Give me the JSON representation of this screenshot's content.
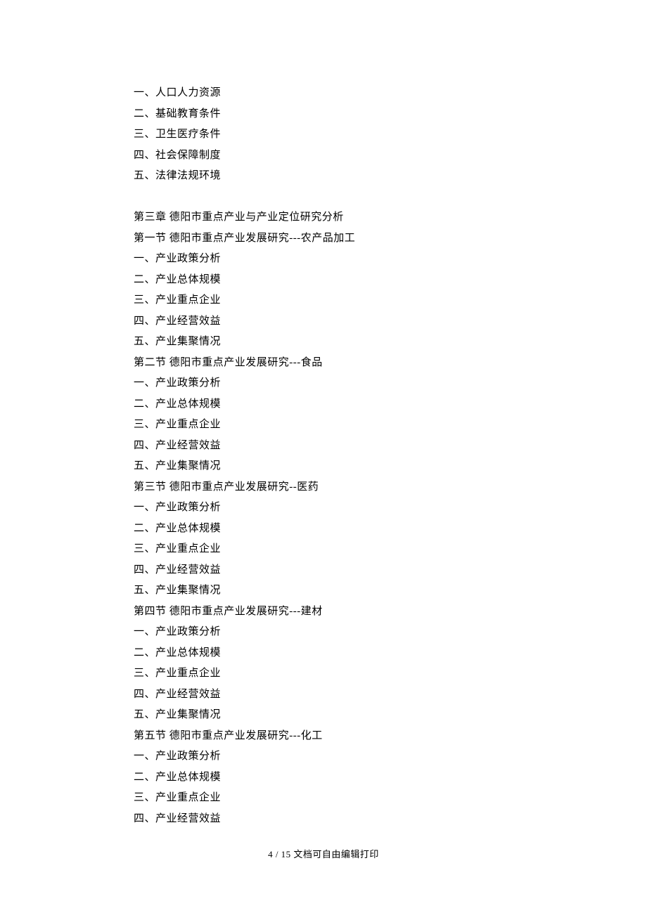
{
  "lines": [
    "一、人口人力资源",
    "二、基础教育条件",
    "三、卫生医疗条件",
    "四、社会保障制度",
    "五、法律法规环境",
    "",
    "第三章  德阳市重点产业与产业定位研究分析",
    "第一节  德阳市重点产业发展研究---农产品加工",
    "一、产业政策分析",
    "二、产业总体规模",
    "三、产业重点企业",
    "四、产业经营效益",
    "五、产业集聚情况",
    "第二节  德阳市重点产业发展研究---食品",
    "一、产业政策分析",
    "二、产业总体规模",
    "三、产业重点企业",
    "四、产业经营效益",
    "五、产业集聚情况",
    "第三节  德阳市重点产业发展研究--医药",
    "一、产业政策分析",
    "二、产业总体规模",
    "三、产业重点企业",
    "四、产业经营效益",
    "五、产业集聚情况",
    "第四节  德阳市重点产业发展研究---建材",
    "一、产业政策分析",
    "二、产业总体规模",
    "三、产业重点企业",
    "四、产业经营效益",
    "五、产业集聚情况",
    "第五节  德阳市重点产业发展研究---化工",
    "一、产业政策分析",
    "二、产业总体规模",
    "三、产业重点企业",
    "四、产业经营效益"
  ],
  "footer": "4 / 15 文档可自由编辑打印"
}
